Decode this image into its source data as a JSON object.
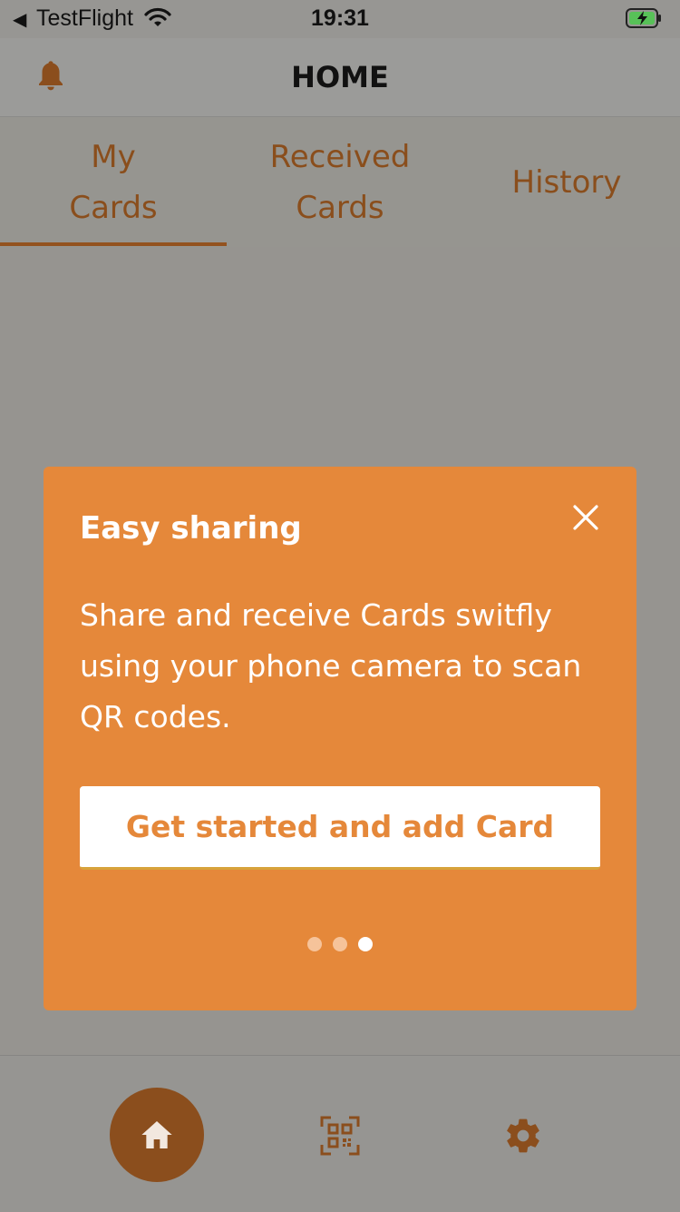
{
  "status_bar": {
    "back_glyph": "◀",
    "app": "TestFlight",
    "time": "19:31",
    "icons": [
      "wifi-icon",
      "battery-charging-icon"
    ]
  },
  "header": {
    "title": "HOME",
    "icon": "bell-icon"
  },
  "tabs": [
    {
      "line1": "My",
      "line2": "Cards",
      "active": true
    },
    {
      "line1": "Received",
      "line2": "Cards",
      "active": false
    },
    {
      "line1": "History",
      "line2": "",
      "active": false
    }
  ],
  "modal": {
    "title": "Easy sharing",
    "body": "Share and receive Cards switfly using your phone camera to scan QR codes.",
    "cta_label": "Get started and add Card",
    "close_icon": "close-icon",
    "pagination": {
      "count": 3,
      "active_index": 2
    }
  },
  "bottom_nav": {
    "items": [
      "home-icon",
      "qr-code-icon",
      "gear-icon"
    ],
    "active": "home-icon"
  },
  "colors": {
    "accent": "#e5883a",
    "brand_dark": "#8b4e1d",
    "overlay_bg": "#979693",
    "tab_text": "#8a4e1c"
  }
}
